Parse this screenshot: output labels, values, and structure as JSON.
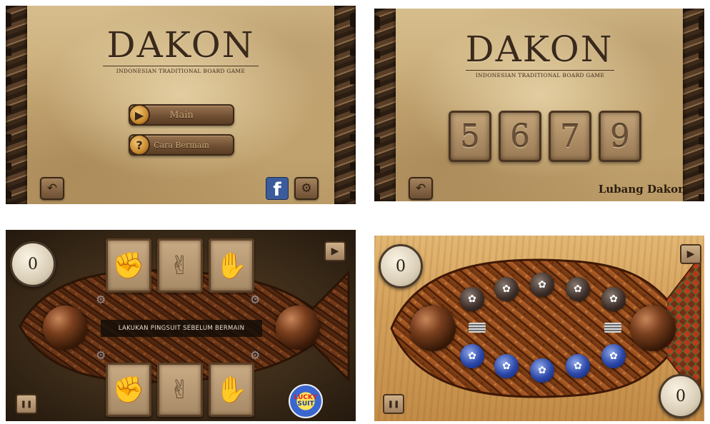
{
  "main_menu": {
    "title": "DAKON",
    "subtitle": "INDONESIAN TRADITIONAL BOARD GAME",
    "play_label": "Main",
    "howto_label": "Cara Bermain",
    "play_icon": "play-icon",
    "howto_icon": "question-icon",
    "facebook_glyph": "f",
    "back_glyph": "↶",
    "settings_glyph": "⚙"
  },
  "pit_select": {
    "title": "DAKON",
    "subtitle": "INDONESIAN TRADITIONAL BOARD GAME",
    "options": [
      "5",
      "6",
      "7",
      "9"
    ],
    "caption": "Lubang Dakon",
    "back_glyph": "↶"
  },
  "suit_screen": {
    "score_top": "0",
    "message": "LAKUKAN PINGSUIT SEBELUM BERMAIN",
    "top_hands": [
      "✊",
      "✌",
      "✋"
    ],
    "bottom_hands": [
      "✊",
      "✌",
      "✋"
    ],
    "lucky_top": "LUCKY",
    "lucky_bottom": "SUIT",
    "play_glyph": "▶",
    "pause_glyph": "❚❚"
  },
  "board": {
    "score_top": "0",
    "score_bottom": "0",
    "play_glyph": "▶",
    "pause_glyph": "❚❚",
    "top_seeds": [
      "✿",
      "✿",
      "✿",
      "✿",
      "✿"
    ],
    "bottom_seeds": [
      "✿",
      "✿",
      "✿",
      "✿",
      "✿"
    ]
  }
}
